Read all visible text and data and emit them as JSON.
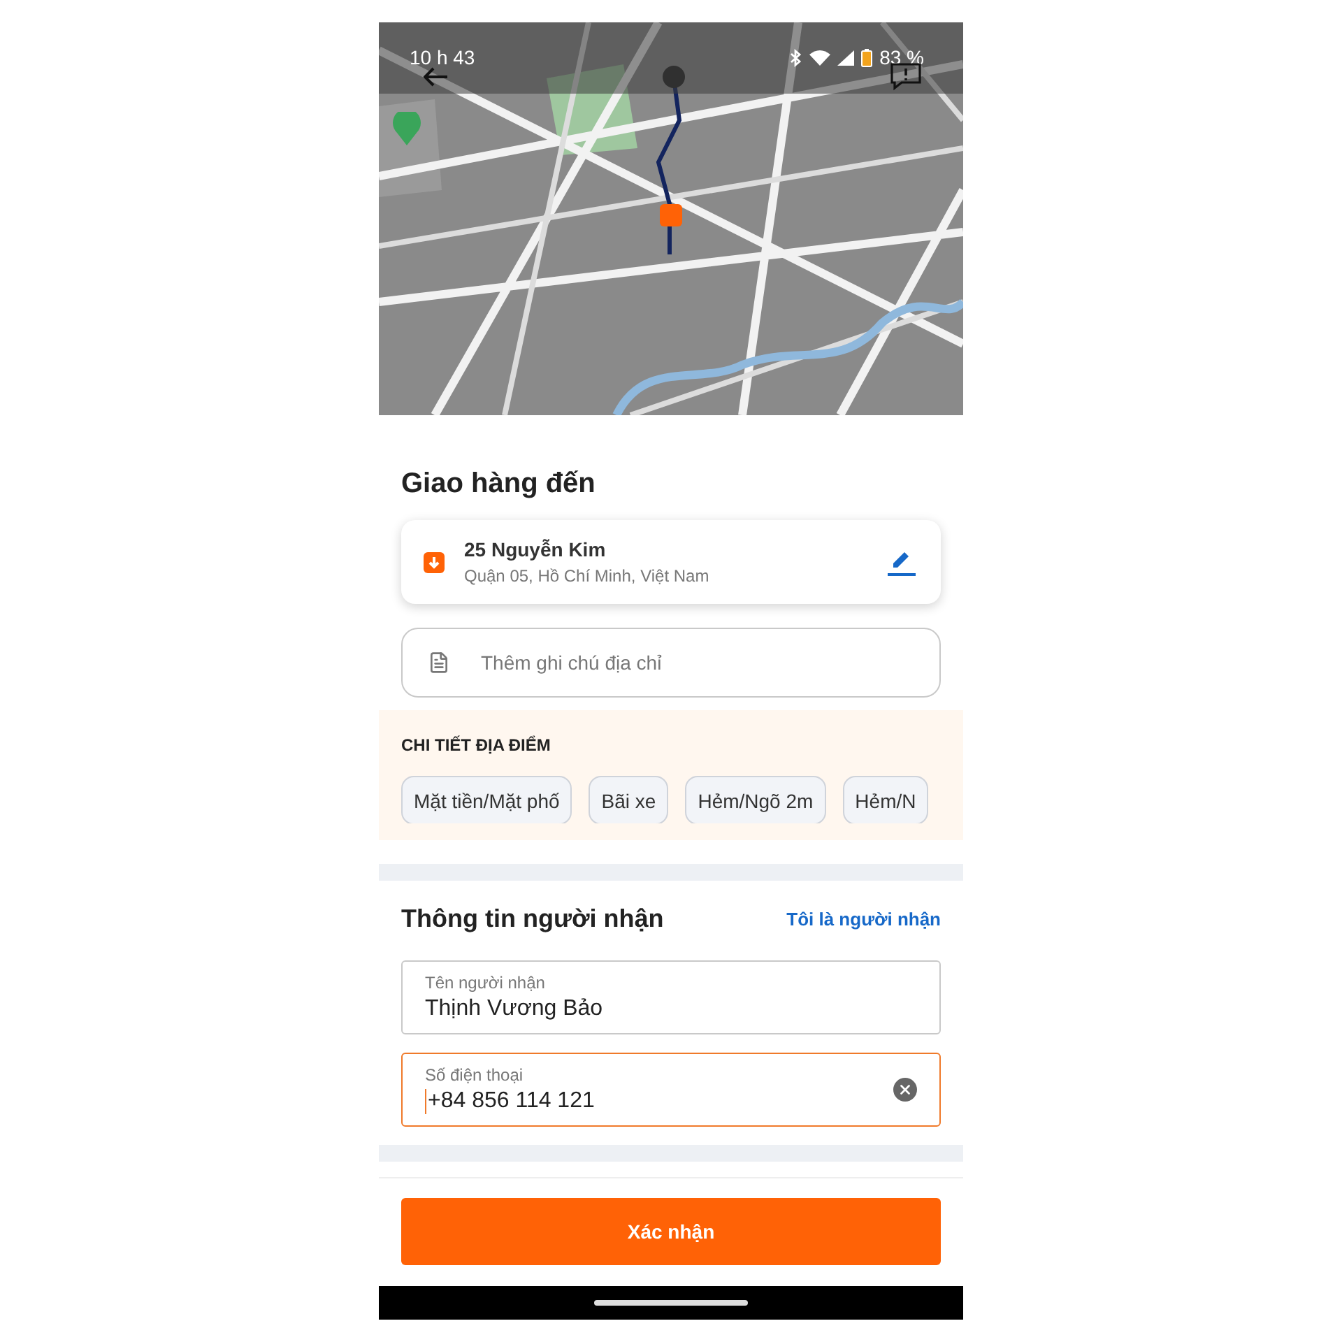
{
  "status_bar": {
    "time": "10 h 43",
    "battery": "83 %"
  },
  "delivery": {
    "title": "Giao hàng đến",
    "address_line": "25 Nguyễn Kim",
    "address_detail": "Quận 05, Hồ Chí Minh, Việt Nam",
    "note_placeholder": "Thêm ghi chú địa chỉ"
  },
  "location_details": {
    "heading": "CHI TIẾT ĐỊA ĐIỂM",
    "chips": [
      {
        "label": "Mặt tiền/Mặt phố"
      },
      {
        "label": "Bãi xe"
      },
      {
        "label": "Hẻm/Ngõ 2m"
      },
      {
        "label": "Hẻm/N"
      }
    ]
  },
  "recipient": {
    "title": "Thông tin người nhận",
    "self_link": "Tôi là người nhận",
    "fields": [
      {
        "label": "Tên người nhận",
        "value": "Thịnh Vương Bảo",
        "focused": false
      },
      {
        "label": "Số điện thoại",
        "value": "+84 856 114 121",
        "focused": true
      }
    ]
  },
  "confirm_button": "Xác nhận"
}
